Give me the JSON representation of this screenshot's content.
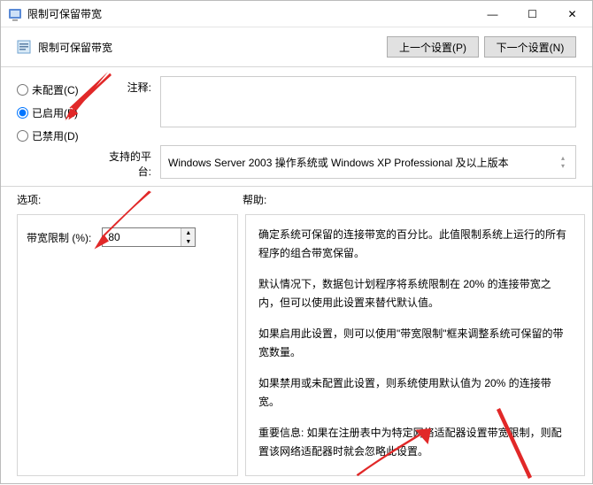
{
  "window": {
    "title": "限制可保留带宽",
    "minimize_icon": "—",
    "maximize_icon": "☐",
    "close_icon": "✕"
  },
  "header": {
    "title": "限制可保留带宽",
    "prev_label": "上一个设置(P)",
    "next_label": "下一个设置(N)"
  },
  "config": {
    "radio_not_configured": "未配置(C)",
    "radio_enabled": "已启用(E)",
    "radio_disabled": "已禁用(D)",
    "comment_label": "注释:",
    "comment_value": "",
    "supported_label": "支持的平台:",
    "supported_value": "Windows Server 2003 操作系统或 Windows XP Professional 及以上版本"
  },
  "labels": {
    "options": "选项:",
    "help": "帮助:"
  },
  "options": {
    "bandwidth_limit_label": "带宽限制 (%):",
    "bandwidth_limit_value": "80"
  },
  "help": {
    "p1": "确定系统可保留的连接带宽的百分比。此值限制系统上运行的所有程序的组合带宽保留。",
    "p2": "默认情况下，数据包计划程序将系统限制在 20% 的连接带宽之内，但可以使用此设置来替代默认值。",
    "p3": "如果启用此设置，则可以使用\"带宽限制\"框来调整系统可保留的带宽数量。",
    "p4": "如果禁用或未配置此设置，则系统使用默认值为 20% 的连接带宽。",
    "p5": "重要信息: 如果在注册表中为特定网络适配器设置带宽限制，则配置该网络适配器时就会忽略此设置。"
  }
}
